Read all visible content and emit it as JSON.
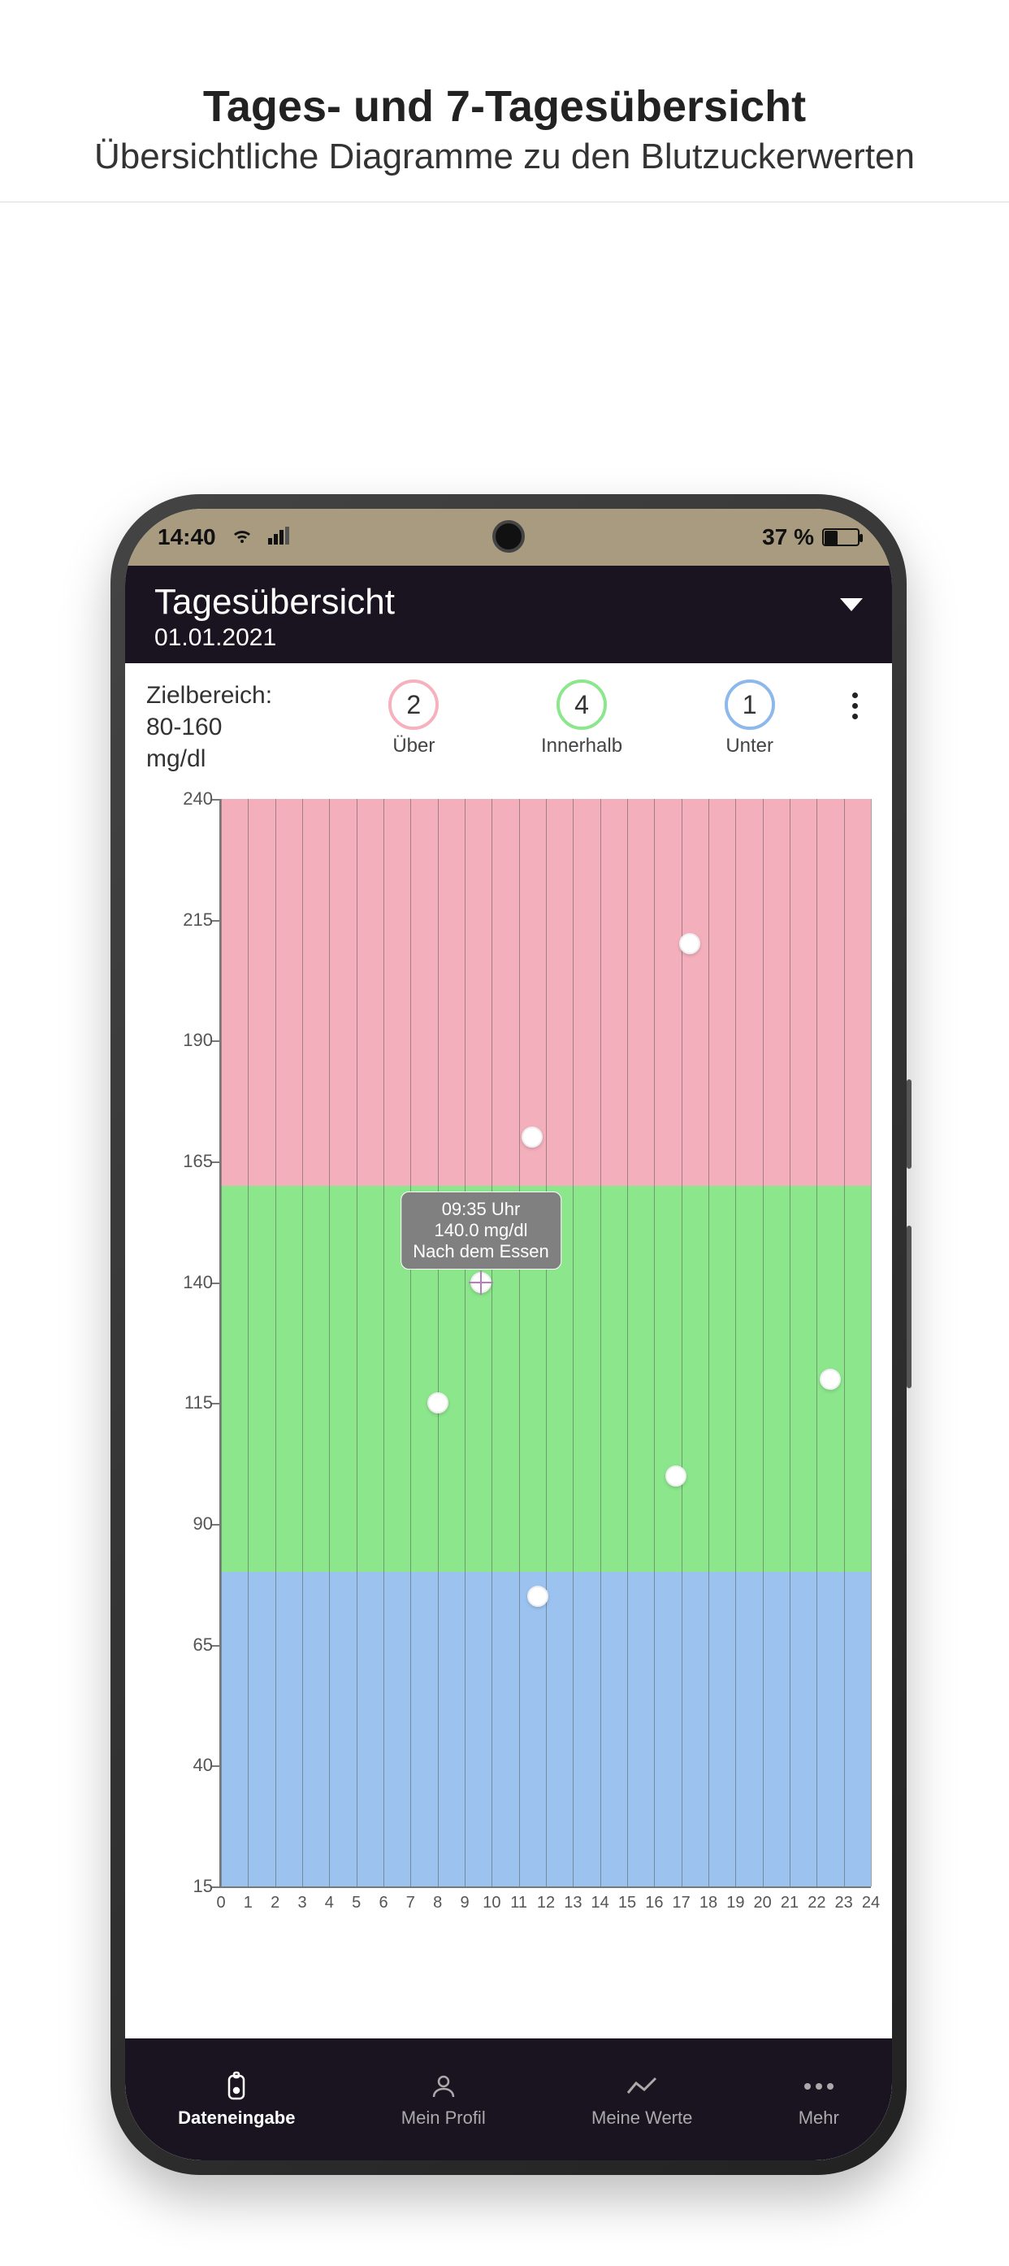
{
  "promo": {
    "title": "Tages- und 7-Tagesübersicht",
    "subtitle": "Übersichtliche Diagramme zu den Blutzuckerwerten"
  },
  "status": {
    "time": "14:40",
    "battery_pct": "37 %"
  },
  "header": {
    "title": "Tagesübersicht",
    "date": "01.01.2021"
  },
  "target": {
    "label": "Zielbereich:",
    "range": "80-160",
    "unit": "mg/dl"
  },
  "stats": {
    "over": {
      "count": "2",
      "label": "Über"
    },
    "within": {
      "count": "4",
      "label": "Innerhalb"
    },
    "under": {
      "count": "1",
      "label": "Unter"
    }
  },
  "tooltip": {
    "time": "09:35 Uhr",
    "value": "140.0 mg/dl",
    "tag": "Nach dem Essen"
  },
  "nav": {
    "data": "Dateneingabe",
    "profile": "Mein Profil",
    "values": "Meine Werte",
    "more": "Mehr"
  },
  "chart_data": {
    "type": "scatter",
    "xlabel": "",
    "ylabel": "",
    "x_range": [
      0,
      24
    ],
    "y_range": [
      15,
      240
    ],
    "x_ticks": [
      0,
      1,
      2,
      3,
      4,
      5,
      6,
      7,
      8,
      9,
      10,
      11,
      12,
      13,
      14,
      15,
      16,
      17,
      18,
      19,
      20,
      21,
      22,
      23,
      24
    ],
    "y_ticks": [
      15,
      40,
      65,
      90,
      115,
      140,
      165,
      190,
      215,
      240
    ],
    "bands": [
      {
        "name": "over",
        "from": 160,
        "to": 240,
        "color": "#f3b0bc"
      },
      {
        "name": "in",
        "from": 80,
        "to": 160,
        "color": "#8ce68c"
      },
      {
        "name": "under",
        "from": 15,
        "to": 80,
        "color": "#9cc3ef"
      }
    ],
    "points": [
      {
        "x": 8.0,
        "y": 115
      },
      {
        "x": 9.6,
        "y": 140,
        "selected": true
      },
      {
        "x": 11.5,
        "y": 170
      },
      {
        "x": 11.7,
        "y": 75
      },
      {
        "x": 16.8,
        "y": 100
      },
      {
        "x": 17.3,
        "y": 210
      },
      {
        "x": 22.5,
        "y": 120
      }
    ]
  }
}
